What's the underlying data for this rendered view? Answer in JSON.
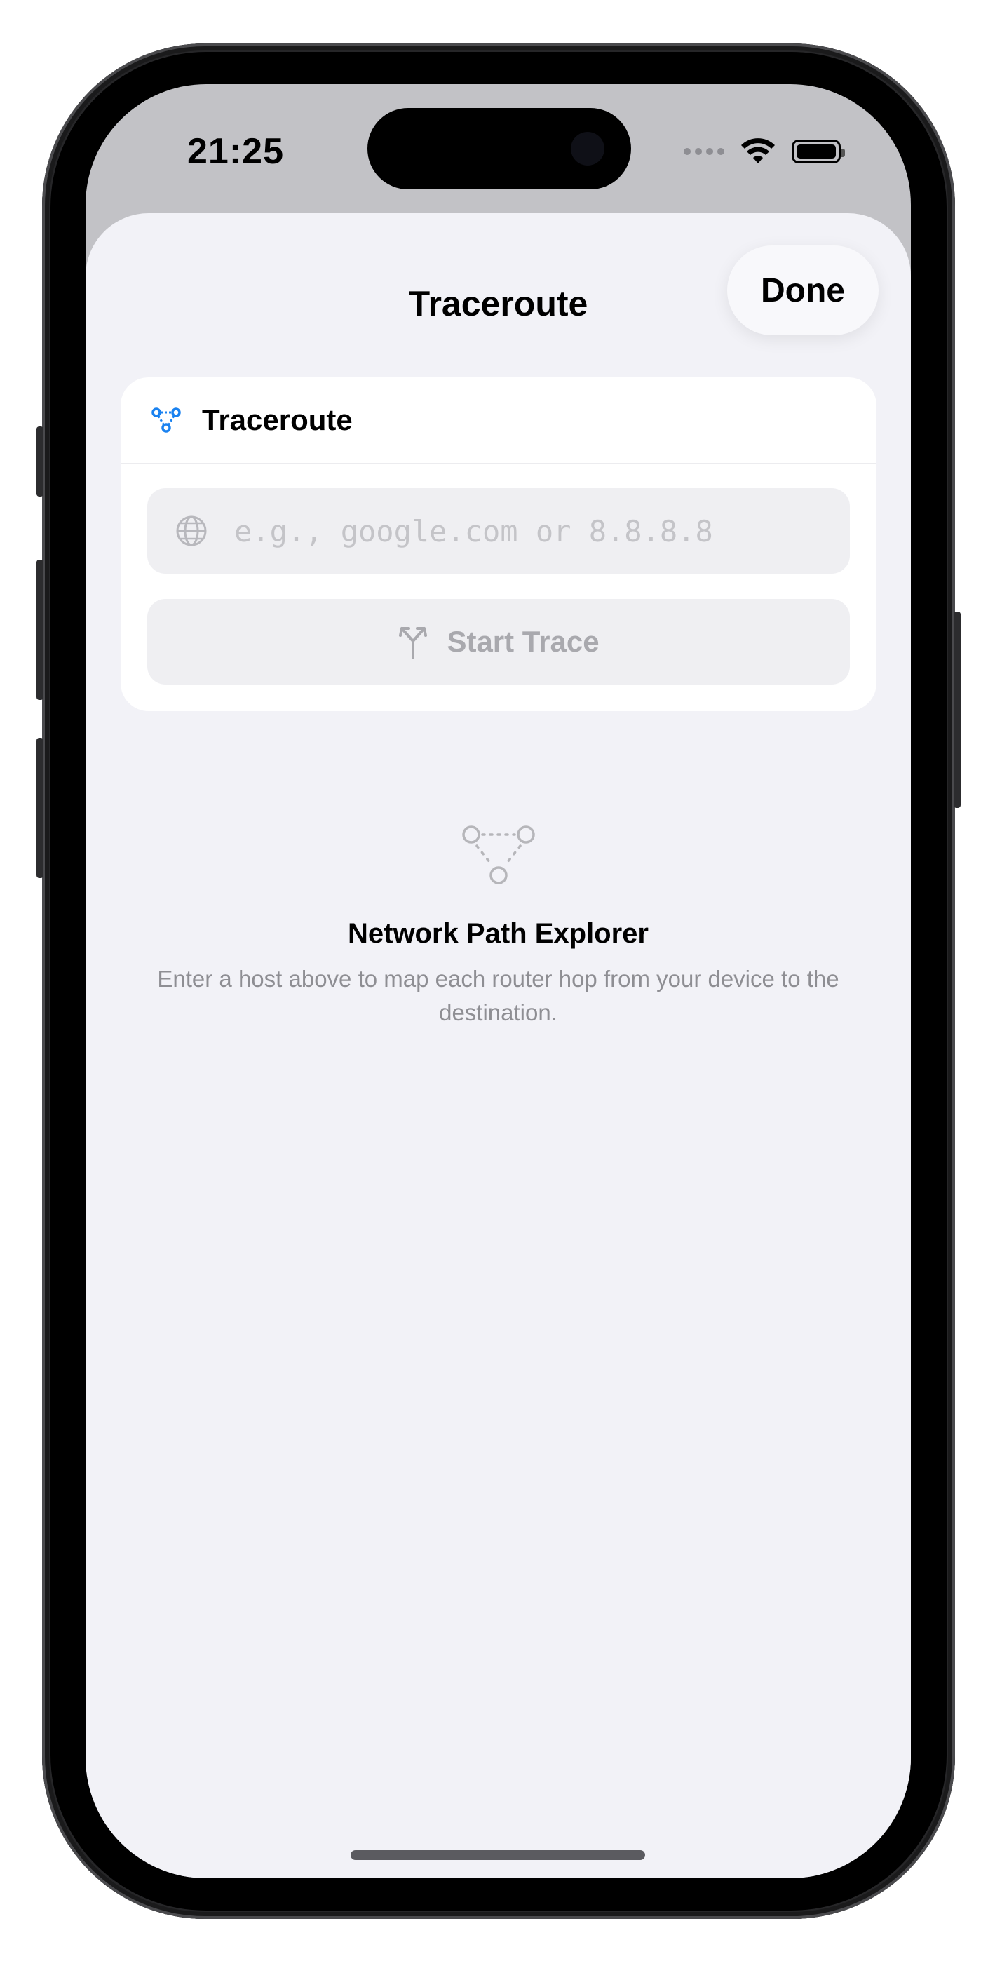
{
  "status_bar": {
    "time": "21:25"
  },
  "nav": {
    "title": "Traceroute",
    "done_label": "Done"
  },
  "card": {
    "title": "Traceroute",
    "host_input_placeholder": "e.g., google.com or 8.8.8.8",
    "host_input_value": "",
    "start_button_label": "Start Trace"
  },
  "empty_state": {
    "title": "Network Path Explorer",
    "subtitle": "Enter a host above to map each router hop from your device to the destination."
  },
  "colors": {
    "accent": "#1a82f0",
    "disabled_text": "#a9a9ae",
    "background": "#f2f2f7"
  },
  "icons": {
    "card_header": "network-path-icon",
    "input": "globe-icon",
    "button": "fork-arrows-icon",
    "empty_state": "route-nodes-icon"
  }
}
